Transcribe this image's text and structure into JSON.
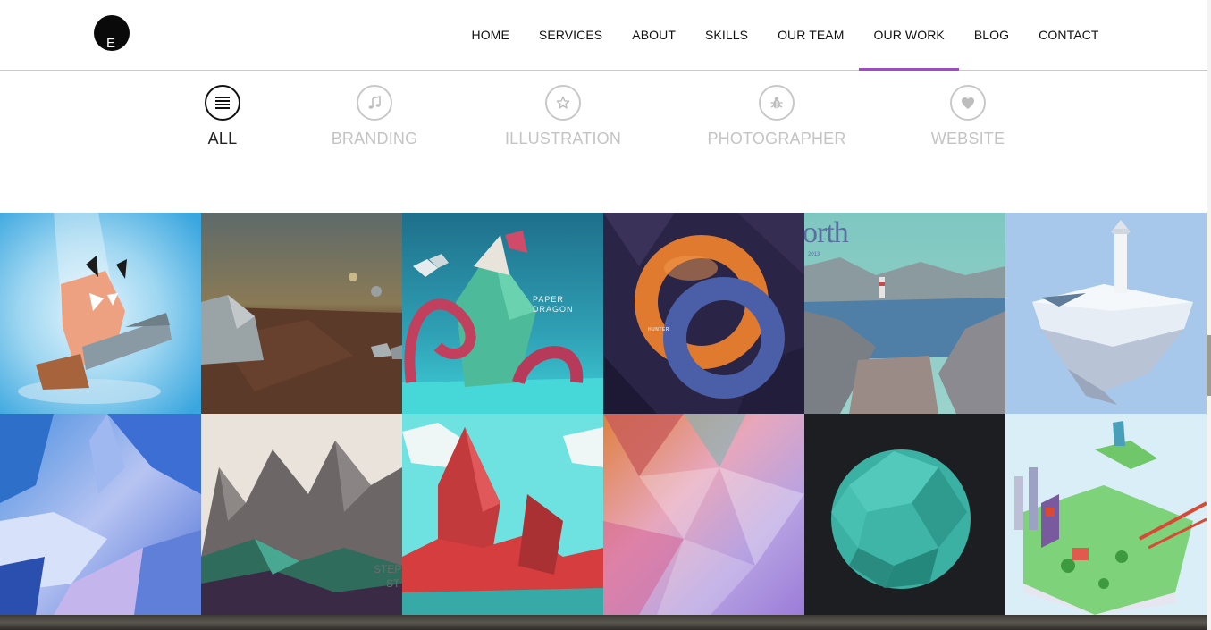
{
  "brand": {
    "logo_letter": "E"
  },
  "nav": {
    "items": [
      {
        "label": "HOME"
      },
      {
        "label": "SERVICES"
      },
      {
        "label": "ABOUT"
      },
      {
        "label": "SKILLS"
      },
      {
        "label": "OUR TEAM"
      },
      {
        "label": "OUR WORK",
        "active": true
      },
      {
        "label": "BLOG"
      },
      {
        "label": "CONTACT"
      }
    ],
    "active_color": "#9b4fbf"
  },
  "filters": [
    {
      "label": "ALL",
      "icon": "list-icon",
      "active": true
    },
    {
      "label": "BRANDING",
      "icon": "music-note-icon"
    },
    {
      "label": "ILLUSTRATION",
      "icon": "star-icon"
    },
    {
      "label": "PHOTOGRAPHER",
      "icon": "bug-icon"
    },
    {
      "label": "WEBSITE",
      "icon": "heart-icon"
    }
  ],
  "portfolio": {
    "tiles": [
      {
        "subject": "lowpoly-character"
      },
      {
        "subject": "desert-planet"
      },
      {
        "subject": "paper-dragon",
        "caption_1": "PAPER",
        "caption_2": "DRAGON"
      },
      {
        "subject": "orange-blue-ring",
        "caption_1": "HUNTER"
      },
      {
        "subject": "north-lake",
        "caption_1": "orth",
        "caption_2": "2013"
      },
      {
        "subject": "floating-lighthouse"
      },
      {
        "subject": "blue-ice-cave"
      },
      {
        "subject": "grey-crystal-mountains",
        "caption_1": "STEP",
        "caption_2": "ST"
      },
      {
        "subject": "red-mountain-clouds"
      },
      {
        "subject": "pastel-triangles"
      },
      {
        "subject": "teal-lowpoly-sphere"
      },
      {
        "subject": "isometric-city-island"
      }
    ]
  }
}
